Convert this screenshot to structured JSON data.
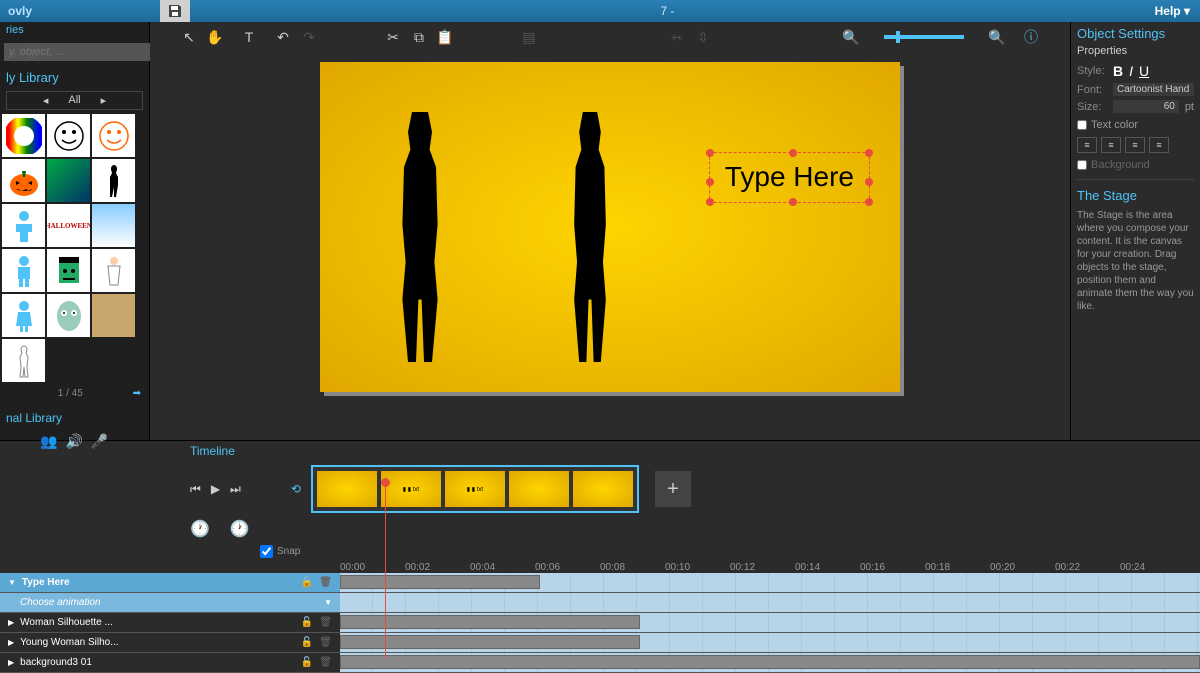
{
  "topbar": {
    "logo": "ovly",
    "title": "7 -",
    "help": "Help"
  },
  "sidebar": {
    "tab": "ries",
    "search_placeholder": "y, object, ...",
    "lib_title": "ly Library",
    "filter": "All",
    "page": "1 / 45",
    "personal_title": "nal Library"
  },
  "canvas": {
    "text_placeholder": "Type Here"
  },
  "right": {
    "title": "Object Settings",
    "props": "Properties",
    "style_label": "Style:",
    "font_label": "Font:",
    "font_value": "Cartoonist Hand",
    "size_label": "Size:",
    "size_value": "60",
    "size_unit": "pt",
    "textcolor": "Text color",
    "background": "Background",
    "stage_title": "The Stage",
    "stage_help": "The Stage is the area where you compose your content. It is the canvas for your creation. Drag objects to the stage, position them and animate them the way you like."
  },
  "timeline": {
    "title": "Timeline",
    "snap": "Snap",
    "times": [
      "00:00",
      "00:02",
      "00:04",
      "00:06",
      "00:08",
      "00:10",
      "00:12",
      "00:14",
      "00:16",
      "00:18",
      "00:20",
      "00:22",
      "00:24"
    ],
    "tracks": [
      {
        "name": "Type Here",
        "active": true
      },
      {
        "name": "Choose animation",
        "sub": true
      },
      {
        "name": "Woman Silhouette ..."
      },
      {
        "name": "Young Woman Silho..."
      },
      {
        "name": "background3 01"
      }
    ]
  }
}
